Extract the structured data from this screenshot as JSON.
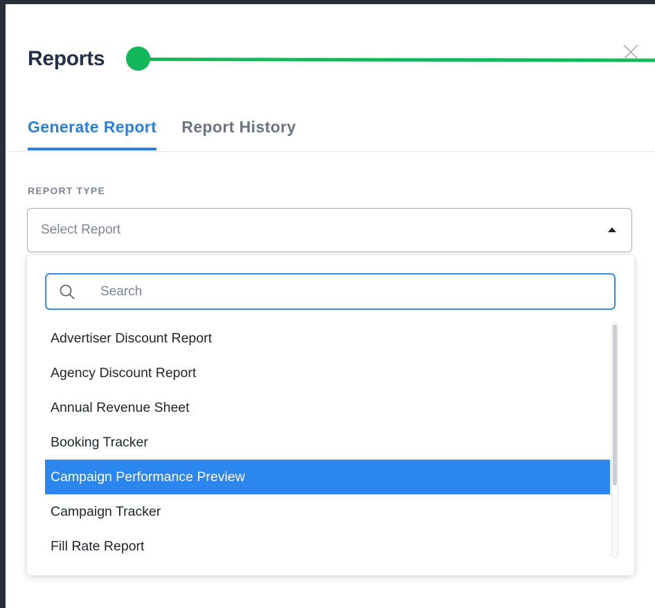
{
  "modal": {
    "title": "Reports"
  },
  "tabs": [
    {
      "label": "Generate Report",
      "active": true
    },
    {
      "label": "Report History",
      "active": false
    }
  ],
  "report_type": {
    "label": "REPORT TYPE",
    "placeholder": "Select Report",
    "expanded": true
  },
  "dropdown": {
    "search_placeholder": "Search",
    "options": [
      "Advertiser Discount Report",
      "Agency Discount Report",
      "Annual Revenue Sheet",
      "Booking Tracker",
      "Campaign Performance Preview",
      "Campaign Tracker",
      "Fill Rate Report"
    ],
    "highlighted": "Campaign Performance Preview"
  },
  "icons": {
    "close": "close-icon",
    "search": "search-icon",
    "caret": "caret-up-icon"
  },
  "colors": {
    "accent": "#2b7fdc",
    "highlight": "#2b86ee",
    "annotation": "#12b85a",
    "title": "#22304a"
  }
}
